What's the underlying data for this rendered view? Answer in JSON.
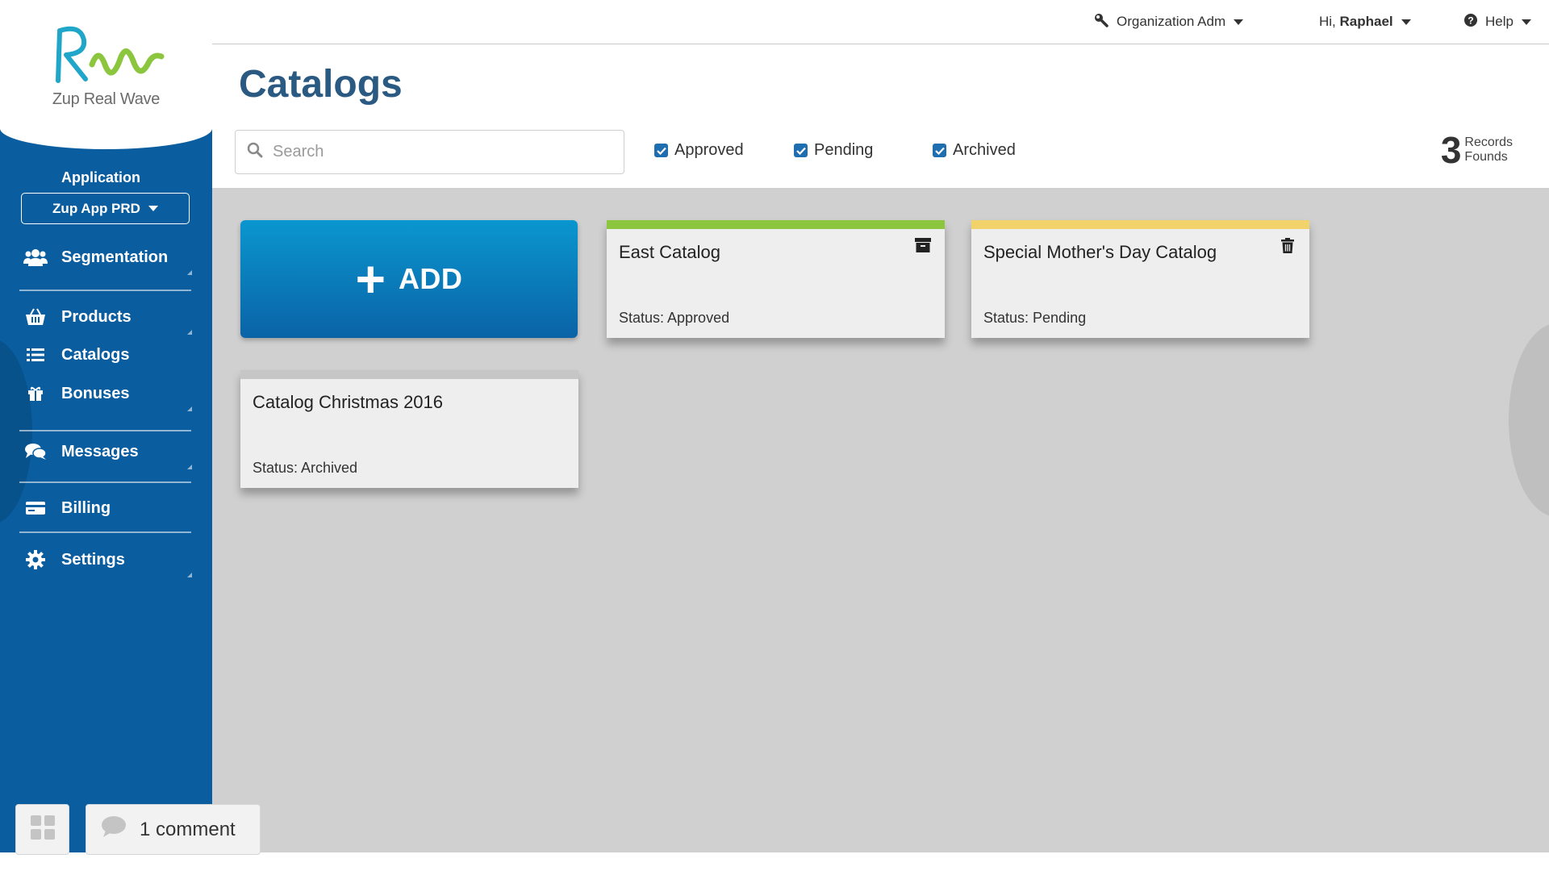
{
  "brand": {
    "name": "Zup Real Wave"
  },
  "sidebar": {
    "application_label": "Application",
    "app_select_value": "Zup App PRD",
    "items": [
      {
        "label": "Segmentation",
        "icon": "users-icon"
      },
      {
        "label": "Products",
        "icon": "basket-icon"
      },
      {
        "label": "Catalogs",
        "icon": "list-icon"
      },
      {
        "label": "Bonuses",
        "icon": "gift-icon"
      },
      {
        "label": "Messages",
        "icon": "chat-icon"
      },
      {
        "label": "Billing",
        "icon": "credit-card-icon"
      },
      {
        "label": "Settings",
        "icon": "gear-icon"
      }
    ]
  },
  "topbar": {
    "org_label": "Organization Adm",
    "greeting": "Hi,",
    "user_name": "Raphael",
    "help_label": "Help"
  },
  "page": {
    "title": "Catalogs",
    "search_placeholder": "Search",
    "filters": [
      "Approved",
      "Pending",
      "Archived"
    ],
    "records_count": "3",
    "records_label_1": "Records",
    "records_label_2": "Founds"
  },
  "add_card": {
    "label": "ADD"
  },
  "catalogs": [
    {
      "title": "East Catalog",
      "status": "Status: Approved",
      "bar_color": "#8cc63f",
      "action_icon": "archive-icon"
    },
    {
      "title": "Special Mother's Day Catalog",
      "status": "Status: Pending",
      "bar_color": "#f2d36b",
      "action_icon": "trash-icon"
    },
    {
      "title": "Catalog Christmas 2016",
      "status": "Status: Archived",
      "bar_color": "#c6c6c6",
      "action_icon": ""
    }
  ],
  "footer": {
    "comment_label": "1 comment"
  },
  "colors": {
    "sidebar": "#0a5ea0",
    "title": "#2a5a82",
    "accent": "#1f6eb0",
    "content_bg": "#d0d0d0"
  }
}
